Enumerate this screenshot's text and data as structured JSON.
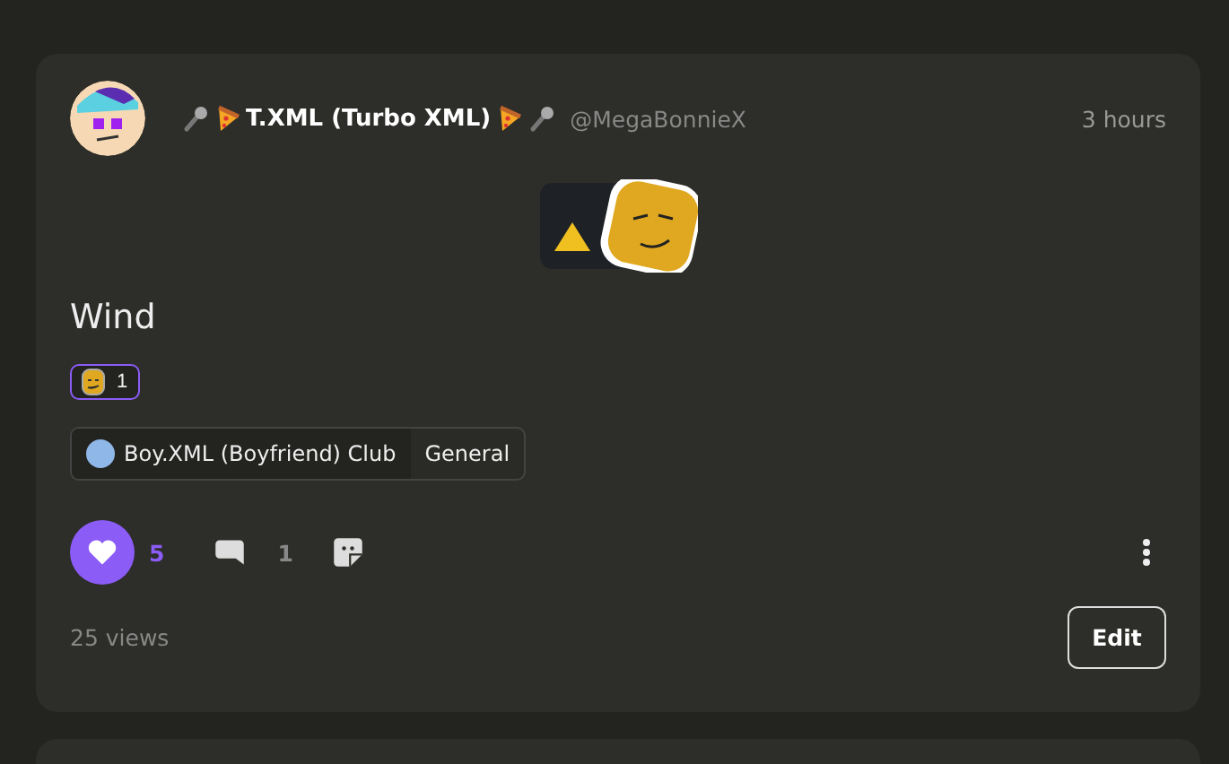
{
  "post": {
    "author": {
      "name": "T.XML (Turbo XML)",
      "handle": "@MegaBonnieX"
    },
    "time": "3 hours",
    "title": "Wind",
    "reactions": [
      {
        "count": "1",
        "selected": true
      }
    ],
    "community": {
      "name": "Boy.XML (Boyfriend) Club",
      "channel": "General"
    },
    "likes": {
      "count": "5",
      "liked": true
    },
    "comments": {
      "count": "1"
    },
    "views": "25 views",
    "edit_button": "Edit"
  }
}
